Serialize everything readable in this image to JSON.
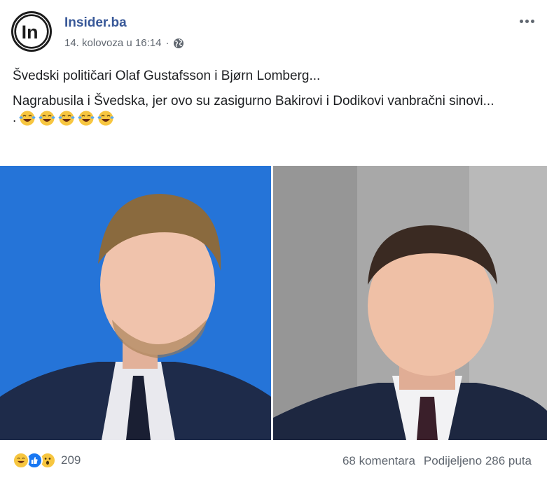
{
  "post": {
    "page_name": "Insider.ba",
    "timestamp": "14. kolovoza u 16:14",
    "separator": "·",
    "audience_icon": "globe-icon",
    "more_icon": "more-horizontal-icon",
    "avatar_text": "In",
    "text_line1": "Švedski političari Olaf Gustafsson i Bjørn Lomberg...",
    "text_line2": "Nagrabusila i Švedska, jer ovo su zasigurno Bakirovi i Dodikovi vanbračni sinovi...",
    "emoji_prefix": ".",
    "emoji_count": 5,
    "emoji_name": "laughing-tears-emoji"
  },
  "photos": [
    {
      "name": "photo-left",
      "background": "#2473d6"
    },
    {
      "name": "photo-right",
      "background": "#a4a4a4"
    }
  ],
  "footer": {
    "reaction_icons": [
      "haha-reaction-icon",
      "like-reaction-icon",
      "wow-reaction-icon"
    ],
    "reaction_count": "209",
    "comments": "68 komentara",
    "shares": "Podijeljeno 286 puta"
  },
  "colors": {
    "link_blue": "#385898",
    "meta_gray": "#606770",
    "like_blue": "#1877f2",
    "emoji_yellow": "#f7c640"
  }
}
